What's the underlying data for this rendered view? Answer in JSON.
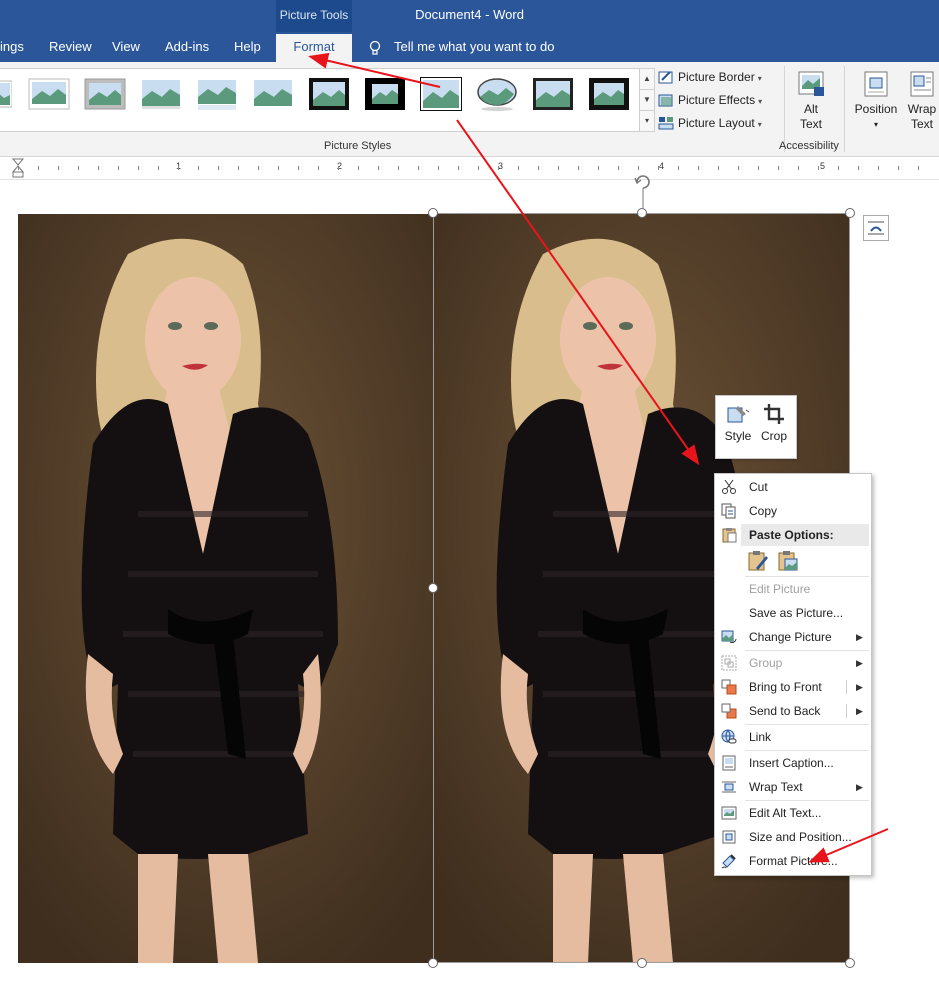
{
  "window": {
    "contextual_group": "Picture Tools",
    "document_title": "Document4 - Word"
  },
  "tabs": [
    {
      "label": "ings"
    },
    {
      "label": "Review"
    },
    {
      "label": "View"
    },
    {
      "label": "Add-ins"
    },
    {
      "label": "Help"
    },
    {
      "label": "Format",
      "active": true
    }
  ],
  "tell_me": "Tell me what you want to do",
  "ribbon": {
    "picture_styles_label": "Picture Styles",
    "picture_border": "Picture Border",
    "picture_effects": "Picture Effects",
    "picture_layout": "Picture Layout",
    "accessibility_label": "Accessibility",
    "alt_text_line1": "Alt",
    "alt_text_line2": "Text",
    "position": "Position",
    "wrap_text_line1": "Wrap",
    "wrap_text_line2": "Text"
  },
  "ruler_numbers": [
    "1",
    "2",
    "3",
    "4",
    "5"
  ],
  "mini_toolbar": {
    "style": "Style",
    "crop": "Crop"
  },
  "context_menu": {
    "cut": "Cut",
    "copy": "Copy",
    "paste_options": "Paste Options:",
    "edit_picture": "Edit Picture",
    "save_as_picture": "Save as Picture...",
    "change_picture": "Change Picture",
    "group": "Group",
    "bring_to_front": "Bring to Front",
    "send_to_back": "Send to Back",
    "link": "Link",
    "insert_caption": "Insert Caption...",
    "wrap_text": "Wrap Text",
    "edit_alt_text": "Edit Alt Text...",
    "size_and_position": "Size and Position...",
    "format_picture": "Format Picture..."
  },
  "colors": {
    "title_bar": "#2b579a",
    "ribbon_bg": "#f3f3f3",
    "annotation_arrow": "#e8141c",
    "photo_background": "#4e3a26"
  }
}
